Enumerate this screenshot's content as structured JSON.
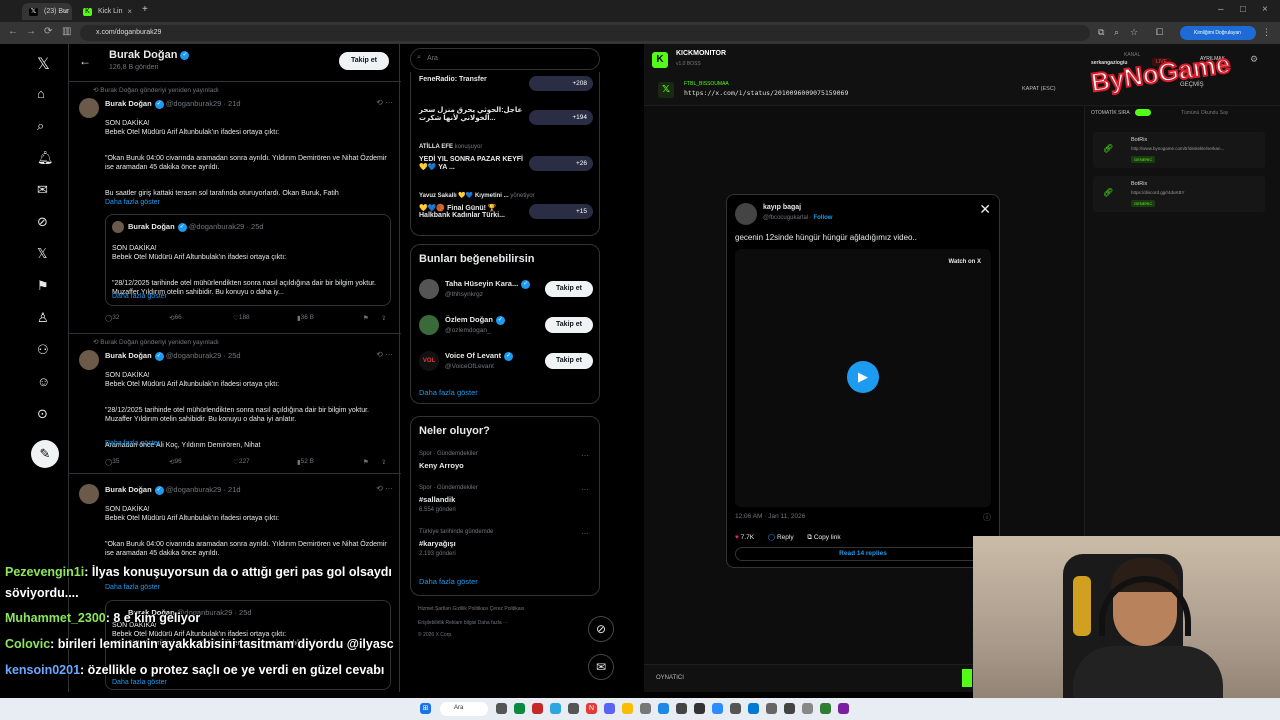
{
  "browser": {
    "tabs": [
      {
        "label": "(23) Bur",
        "active": true
      },
      {
        "label": "Kick Lin",
        "active": false
      }
    ],
    "url": "x.com/doganburak29",
    "profile_label": "Kimliğimi Doğrulayan"
  },
  "x_header": {
    "name": "Burak Doğan",
    "post_count": "126,8 B gönderi",
    "follow_label": "Takip et"
  },
  "search": {
    "placeholder": "Ara"
  },
  "posts": [
    {
      "repost": "Burak Doğan gönderiyi yeniden yayınladı",
      "name": "Burak Doğan",
      "handle": "@doganburak29 · 21d",
      "lines": [
        "SON DAKİKA!\nBebek Otel Müdürü Arif Altunbulak'ın ifadesi ortaya çıktı:",
        "\"Okan Buruk 04:00 civarında aramadan sonra ayrıldı. Yıldırım Demirören ve Nihat Özdemir ise aramadan 45 dakika önce ayrıldı.",
        "Bu saatler giriş kattaki terasın sol tarafında oturuyorlardı. Okan Buruk, Fatih"
      ],
      "more": "Daha fazla göster",
      "quote": {
        "name": "Burak Doğan",
        "handle": "@doganburak29 · 25d",
        "lines": [
          "SON DAKİKA!\nBebek Otel Müdürü Arif Altunbulak'ın ifadesi ortaya çıktı:",
          "\"28/12/2025 tarihinde otel mühürlendikten sonra nasıl açıldığına dair bir bilgim yoktur. Muzaffer Yıldırım otelin sahibidir. Bu konuyu o daha iy..."
        ],
        "more": "Daha fazla göster"
      },
      "stats": {
        "replies": "32",
        "reposts": "66",
        "likes": "188",
        "views": "36 B"
      }
    },
    {
      "repost": "Burak Doğan gönderiyi yeniden yayınladı",
      "name": "Burak Doğan",
      "handle": "@doganburak29 · 25d",
      "lines": [
        "SON DAKİKA!\nBebek Otel Müdürü Arif Altunbulak'ın ifadesi ortaya çıktı:",
        "\"28/12/2025 tarihinde otel mühürlendikten sonra nasıl açıldığına dair bir bilgim yoktur. Muzaffer Yıldırım otelin sahibidir. Bu konuyu o daha iyi anlatır.",
        "Aramadan önce Ali Koç, Yıldırım Demirören, Nihat"
      ],
      "more": "Daha fazla göster",
      "stats": {
        "replies": "35",
        "reposts": "96",
        "likes": "227",
        "views": "52 B"
      }
    },
    {
      "name": "Burak Doğan",
      "handle": "@doganburak29 · 21d",
      "lines": [
        "SON DAKİKA!\nBebek Otel Müdürü Arif Altunbulak'ın ifadesi ortaya çıktı:",
        "\"Okan Buruk 04:00 civarında aramadan sonra ayrıldı. Yıldırım Demirören ve Nihat Özdemir ise aramadan 45 dakika önce ayrıldı."
      ],
      "more": "Daha fazla göster",
      "quote_name": "Burak Doğan",
      "quote_handle": "@doganburak29 · 25d",
      "quote_lines": "SON DAKİKA!\nBebek Otel Müdürü Arif Altunbulak'ın ifadesi ortaya çıktı:\n\"28/12/2025 tarihinde otel mühürlendikten sonra nasıl açıldığına dair",
      "quote_more": "Daha fazla göster"
    }
  ],
  "trending_top": [
    {
      "title": "FeneRadio: Transfer",
      "count": "+208"
    },
    {
      "title": "عاجل:الحوثي يحرق منزل سحر الخولاني لأنها شكرت...",
      "count": "+194"
    },
    {
      "author": "ATİLLA EFE",
      "tag": "konuşuyor",
      "title": "YEDİ YIL SONRA PAZAR KEYFİ 💛💙 YA ...",
      "count": "+26"
    },
    {
      "author": "Yavuz Sakallı 💛💙 Kıymetini ...",
      "tag": "yönetiyor",
      "title": "💛💙🏀 Final Günü! 🏆 Halkbank Kadınlar Türki...",
      "count": "+15"
    }
  ],
  "suggestions": {
    "title": "Bunları beğenebilirsin",
    "items": [
      {
        "name": "Taha Hüseyin Kara...",
        "handle": "@thhsynkrgz",
        "btn": "Takip et"
      },
      {
        "name": "Özlem Doğan",
        "handle": "@ozlemdogan_",
        "btn": "Takip et"
      },
      {
        "name": "Voice Of Levant",
        "handle": "@VoiceOfLevant",
        "btn": "Takip et"
      }
    ],
    "more": "Daha fazla göster"
  },
  "whats_happening": {
    "title": "Neler oluyor?",
    "items": [
      {
        "cat": "Spor · Gündemdekiler",
        "name": "Keny Arroyo",
        "count": ""
      },
      {
        "cat": "Spor · Gündemdekiler",
        "name": "#sallandik",
        "count": "6.554 gönderi"
      },
      {
        "cat": "Türkiye tarihinde gündemde",
        "name": "#karyağışı",
        "count": "2.193 gönderi"
      }
    ],
    "more": "Daha fazla göster"
  },
  "footer_links": {
    "line1": "Hizmet Şartları   Gizlilik Politikası   Çerez Politikası",
    "line2": "Erişilebilirlik   Reklam bilgisi   Daha fazla ···",
    "line3": "© 2026 X Corp."
  },
  "kick": {
    "title": "KICKMONITOR",
    "version": "v1.0 BOSS",
    "user": "FTBL_BISSOUMAA",
    "url": "https://x.com/i/status/2010096009075159069",
    "close": "KAPAT (ESC)",
    "channel_label": "KANAL",
    "channel": "serkangaziogiu",
    "live": "LIVE",
    "ayrilmak": "AYRILMAK",
    "history": "GEÇMİŞ",
    "auto_label": "OTOMATİK SIRA",
    "clear_all": "Tümünü Okundu Say",
    "items": [
      {
        "name": "BotRix",
        "link": "http://www.bynogame.com/tr/destekle/serkan...",
        "tag": "GENERIC"
      },
      {
        "name": "BotRix",
        "link": "https://discord.gg/r4duKBY",
        "tag": "GENERIC"
      }
    ],
    "player_label": "OYNATICI"
  },
  "embed": {
    "name": "kayıp bagaj",
    "handle": "@fbcocugukartal",
    "follow": "Follow",
    "text": "gecenin 12sinde hüngür hüngür ağladığımız video..",
    "watch": "Watch on X",
    "time": "12:06 AM · Jan 11, 2026",
    "likes": "7.7K",
    "reply": "Reply",
    "copy": "Copy link",
    "read": "Read 14 replies"
  },
  "chat": [
    {
      "user": "Pezevengin1i",
      "msg": ": İlyas konuşuyorsun da o attığı geri pas gol olsaydı",
      "cont": "söviyordu...."
    },
    {
      "user": "Muhammet_2300",
      "msg": ": 8 e kim geliyor"
    },
    {
      "user": "Colovic",
      "msg": ": birileri leminanin ayakkabisini tasitmam diyordu @ilyasc"
    },
    {
      "user": "kensoin0201",
      "msg": ": özellikle o protez saçlı oe ye verdi en güzel cevabı"
    }
  ],
  "logo": "ByNoGame",
  "taskbar": {
    "search": "Ara"
  },
  "colors": {
    "accent": "#1d9bf0",
    "kick_green": "#53fc18"
  }
}
